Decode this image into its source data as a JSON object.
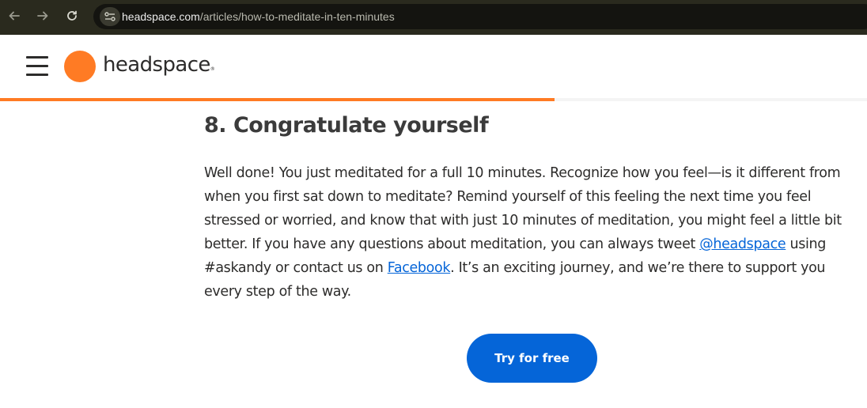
{
  "browser": {
    "url_host": "headspace.com",
    "url_path": "/articles/how-to-meditate-in-ten-minutes"
  },
  "header": {
    "brand": "headspace",
    "brand_mark": "®",
    "brand_color": "#ff7b24",
    "reading_progress": 0.64
  },
  "article": {
    "heading": "8. Congratulate yourself",
    "body_part1": "Well done! You just meditated for a full 10 minutes. Recognize how you feel—is it different from when you first sat down to meditate? Remind yourself of this feeling the next time you feel stressed or worried, and know that with just 10 minutes of meditation, you might feel a little bit better. If you have any questions about meditation, you can always tweet ",
    "twitter_link": "@headspace",
    "body_part2": " using #askandy or contact us on ",
    "facebook_link": "Facebook",
    "body_part3": ". It’s an exciting journey, and we’re there to support you every step of the way.",
    "link_color": "#0565d8"
  },
  "cta": {
    "label": "Try for free",
    "color": "#0565d8"
  }
}
